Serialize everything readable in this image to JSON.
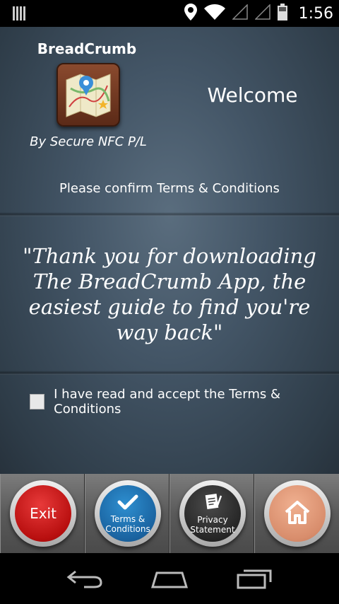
{
  "status_bar": {
    "time": "1:56",
    "icons": [
      "notification-bars-icon",
      "location-icon",
      "wifi-icon",
      "signal-icon",
      "signal-icon",
      "battery-icon"
    ]
  },
  "app": {
    "title": "BreadCrumb",
    "byline": "By Secure NFC P/L",
    "welcome": "Welcome",
    "confirm_text": "Please confirm Terms & Conditions",
    "quote": "\"Thank you for downloading The BreadCrumb App, the easiest guide to find you're way back\"",
    "accept_label": "I have read and accept the Terms & Conditions",
    "accept_checked": false
  },
  "toolbar": {
    "exit_label": "Exit",
    "terms_label_line1": "Terms &",
    "terms_label_line2": "Conditions",
    "privacy_label_line1": "Privacy",
    "privacy_label_line2": "Statement",
    "colors": {
      "exit": "#c41616",
      "terms": "#1f6fae",
      "privacy": "#2a2a2a",
      "home": "#e09a78"
    }
  },
  "nav_bar": {
    "icons": [
      "back-icon",
      "home-outline-icon",
      "recent-apps-icon"
    ]
  }
}
